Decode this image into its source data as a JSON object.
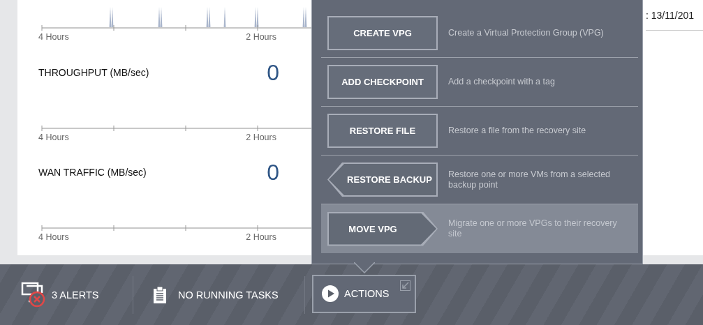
{
  "charts": [
    {
      "kind": "activity",
      "axis_labels": [
        "4 Hours",
        "2 Hours"
      ]
    },
    {
      "kind": "empty",
      "title": "THROUGHPUT (MB/sec)",
      "value": "0",
      "axis_labels": [
        "4 Hours",
        "2 Hours"
      ]
    },
    {
      "kind": "empty",
      "title": "WAN TRAFFIC (MB/sec)",
      "value": "0",
      "axis_labels": [
        "4 Hours",
        "2 Hours"
      ]
    }
  ],
  "date_text": ": 13/11/201",
  "actions_menu": [
    {
      "label": "CREATE VPG",
      "kind": "rect",
      "description": "Create a Virtual Protection Group (VPG)",
      "selected": false
    },
    {
      "label": "ADD CHECKPOINT",
      "kind": "rect",
      "description": "Add a checkpoint with a tag",
      "selected": false
    },
    {
      "label": "RESTORE FILE",
      "kind": "rect",
      "description": "Restore a file from the recovery site",
      "selected": false
    },
    {
      "label": "RESTORE BACKUP",
      "kind": "arrow-left",
      "description": "Restore one or more VMs from a selected backup point",
      "selected": false
    },
    {
      "label": "MOVE VPG",
      "kind": "arrow-right",
      "description": "Migrate one or more VPGs to their recovery site",
      "selected": true
    }
  ],
  "status_bar": {
    "alerts": "3 ALERTS",
    "tasks": "NO RUNNING TASKS",
    "actions": "ACTIONS"
  }
}
